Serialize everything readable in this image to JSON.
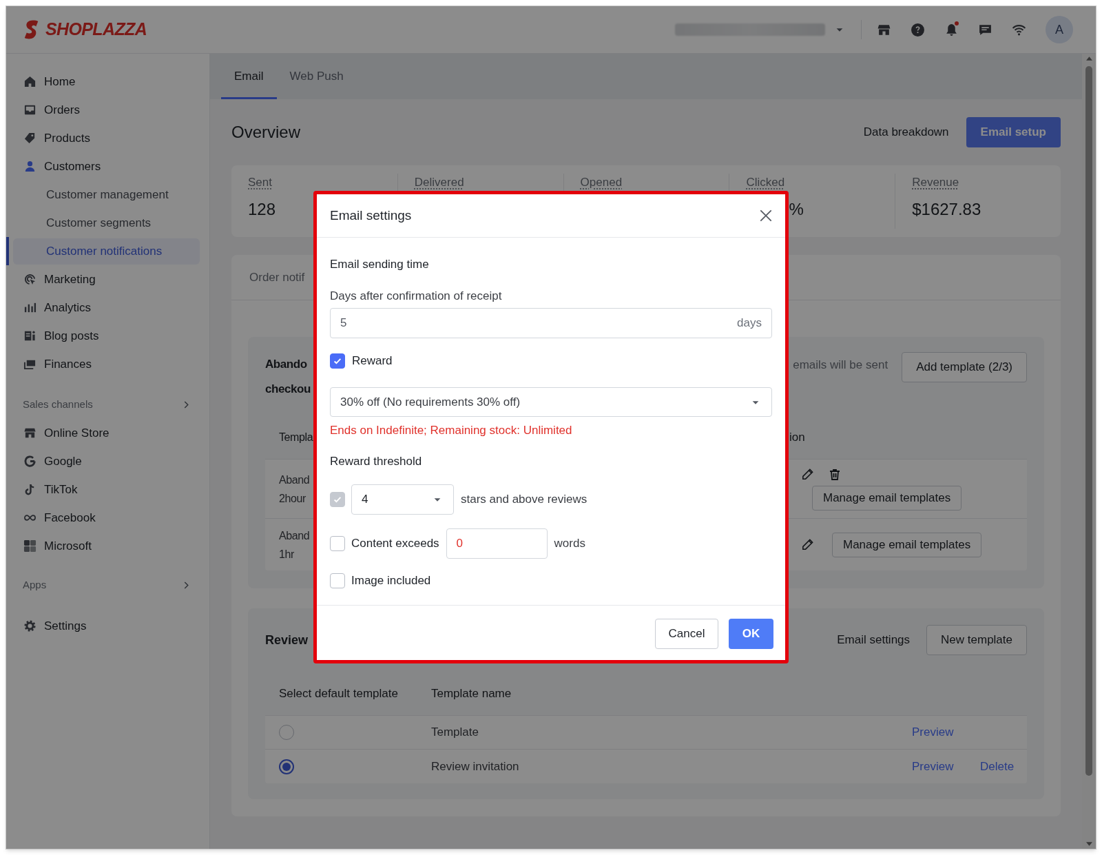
{
  "header": {
    "logo": "SHOPLAZZA",
    "avatar": "A"
  },
  "sidebar": {
    "groups": [
      {
        "items": [
          {
            "label": "Home",
            "expanded": false
          },
          {
            "label": "Orders",
            "expanded": false
          },
          {
            "label": "Products",
            "expanded": false
          },
          {
            "label": "Customers",
            "expanded": true,
            "children": [
              {
                "label": "Customer management",
                "selected": false
              },
              {
                "label": "Customer segments",
                "selected": false
              },
              {
                "label": "Customer notifications",
                "selected": true
              }
            ]
          },
          {
            "label": "Marketing",
            "expanded": false
          },
          {
            "label": "Analytics",
            "expanded": false
          },
          {
            "label": "Blog posts",
            "expanded": false
          },
          {
            "label": "Finances",
            "expanded": false
          }
        ]
      },
      {
        "title": "Sales channels",
        "items": [
          {
            "label": "Online Store",
            "expanded": false
          },
          {
            "label": "Google",
            "expanded": false
          },
          {
            "label": "TikTok",
            "expanded": false
          },
          {
            "label": "Facebook",
            "expanded": false
          },
          {
            "label": "Microsoft",
            "expanded": false
          }
        ]
      },
      {
        "title": "Apps"
      },
      {
        "items": [
          {
            "label": "Settings",
            "expanded": false
          }
        ]
      }
    ]
  },
  "tabs": [
    {
      "label": "Email",
      "selected": true
    },
    {
      "label": "Web Push",
      "selected": false
    }
  ],
  "overview": {
    "title": "Overview",
    "link": "Data breakdown",
    "button": "Email setup",
    "stats": [
      {
        "label": "Sent",
        "value": "128"
      },
      {
        "label": "Delivered"
      },
      {
        "label": "Opened"
      },
      {
        "label": "Clicked",
        "value": "%"
      },
      {
        "label": "Revenue",
        "value": "$1627.83"
      }
    ]
  },
  "notifications": {
    "tab": "Order notif",
    "abandoned": {
      "title_lines": [
        "Abando",
        "checkou"
      ],
      "note": "emails will be sent",
      "button": "Add template (2/3)",
      "columns": [
        "Templa",
        "ion"
      ],
      "rows": [
        {
          "lines": [
            "Aband",
            "2hour"
          ],
          "deletable": true,
          "button": "Manage email templates"
        },
        {
          "lines": [
            "Aband",
            "1hr"
          ],
          "deletable": false,
          "button": "Manage email templates"
        }
      ]
    },
    "review": {
      "title": "Review",
      "link": "Email settings",
      "button": "New template",
      "columns": [
        "Select default template",
        "Template name"
      ],
      "rows": [
        {
          "selected": false,
          "name": "Template",
          "links": [
            "Preview"
          ]
        },
        {
          "selected": true,
          "name": "Review invitation",
          "links": [
            "Preview",
            "Delete"
          ]
        }
      ]
    }
  },
  "dialog": {
    "title": "Email settings",
    "section": "Email sending time",
    "field_label": "Days after confirmation of receipt",
    "field_value": "5",
    "field_suffix": "days",
    "reward": {
      "label": "Reward",
      "checked": true
    },
    "reward_select": "30% off (No requirements 30% off)",
    "reward_note": "Ends on Indefinite; Remaining stock: Unlimited",
    "threshold_title": "Reward threshold",
    "conditions": [
      {
        "kind": "select",
        "checked": true,
        "disabled": true,
        "value": "4",
        "suffix": "stars and above reviews"
      },
      {
        "kind": "input",
        "checked": false,
        "disabled": false,
        "label": "Content exceeds",
        "value": "0",
        "suffix": "words"
      },
      {
        "kind": "plain",
        "checked": false,
        "disabled": false,
        "label": "Image included"
      }
    ],
    "buttons": [
      "Cancel",
      "OK"
    ]
  }
}
